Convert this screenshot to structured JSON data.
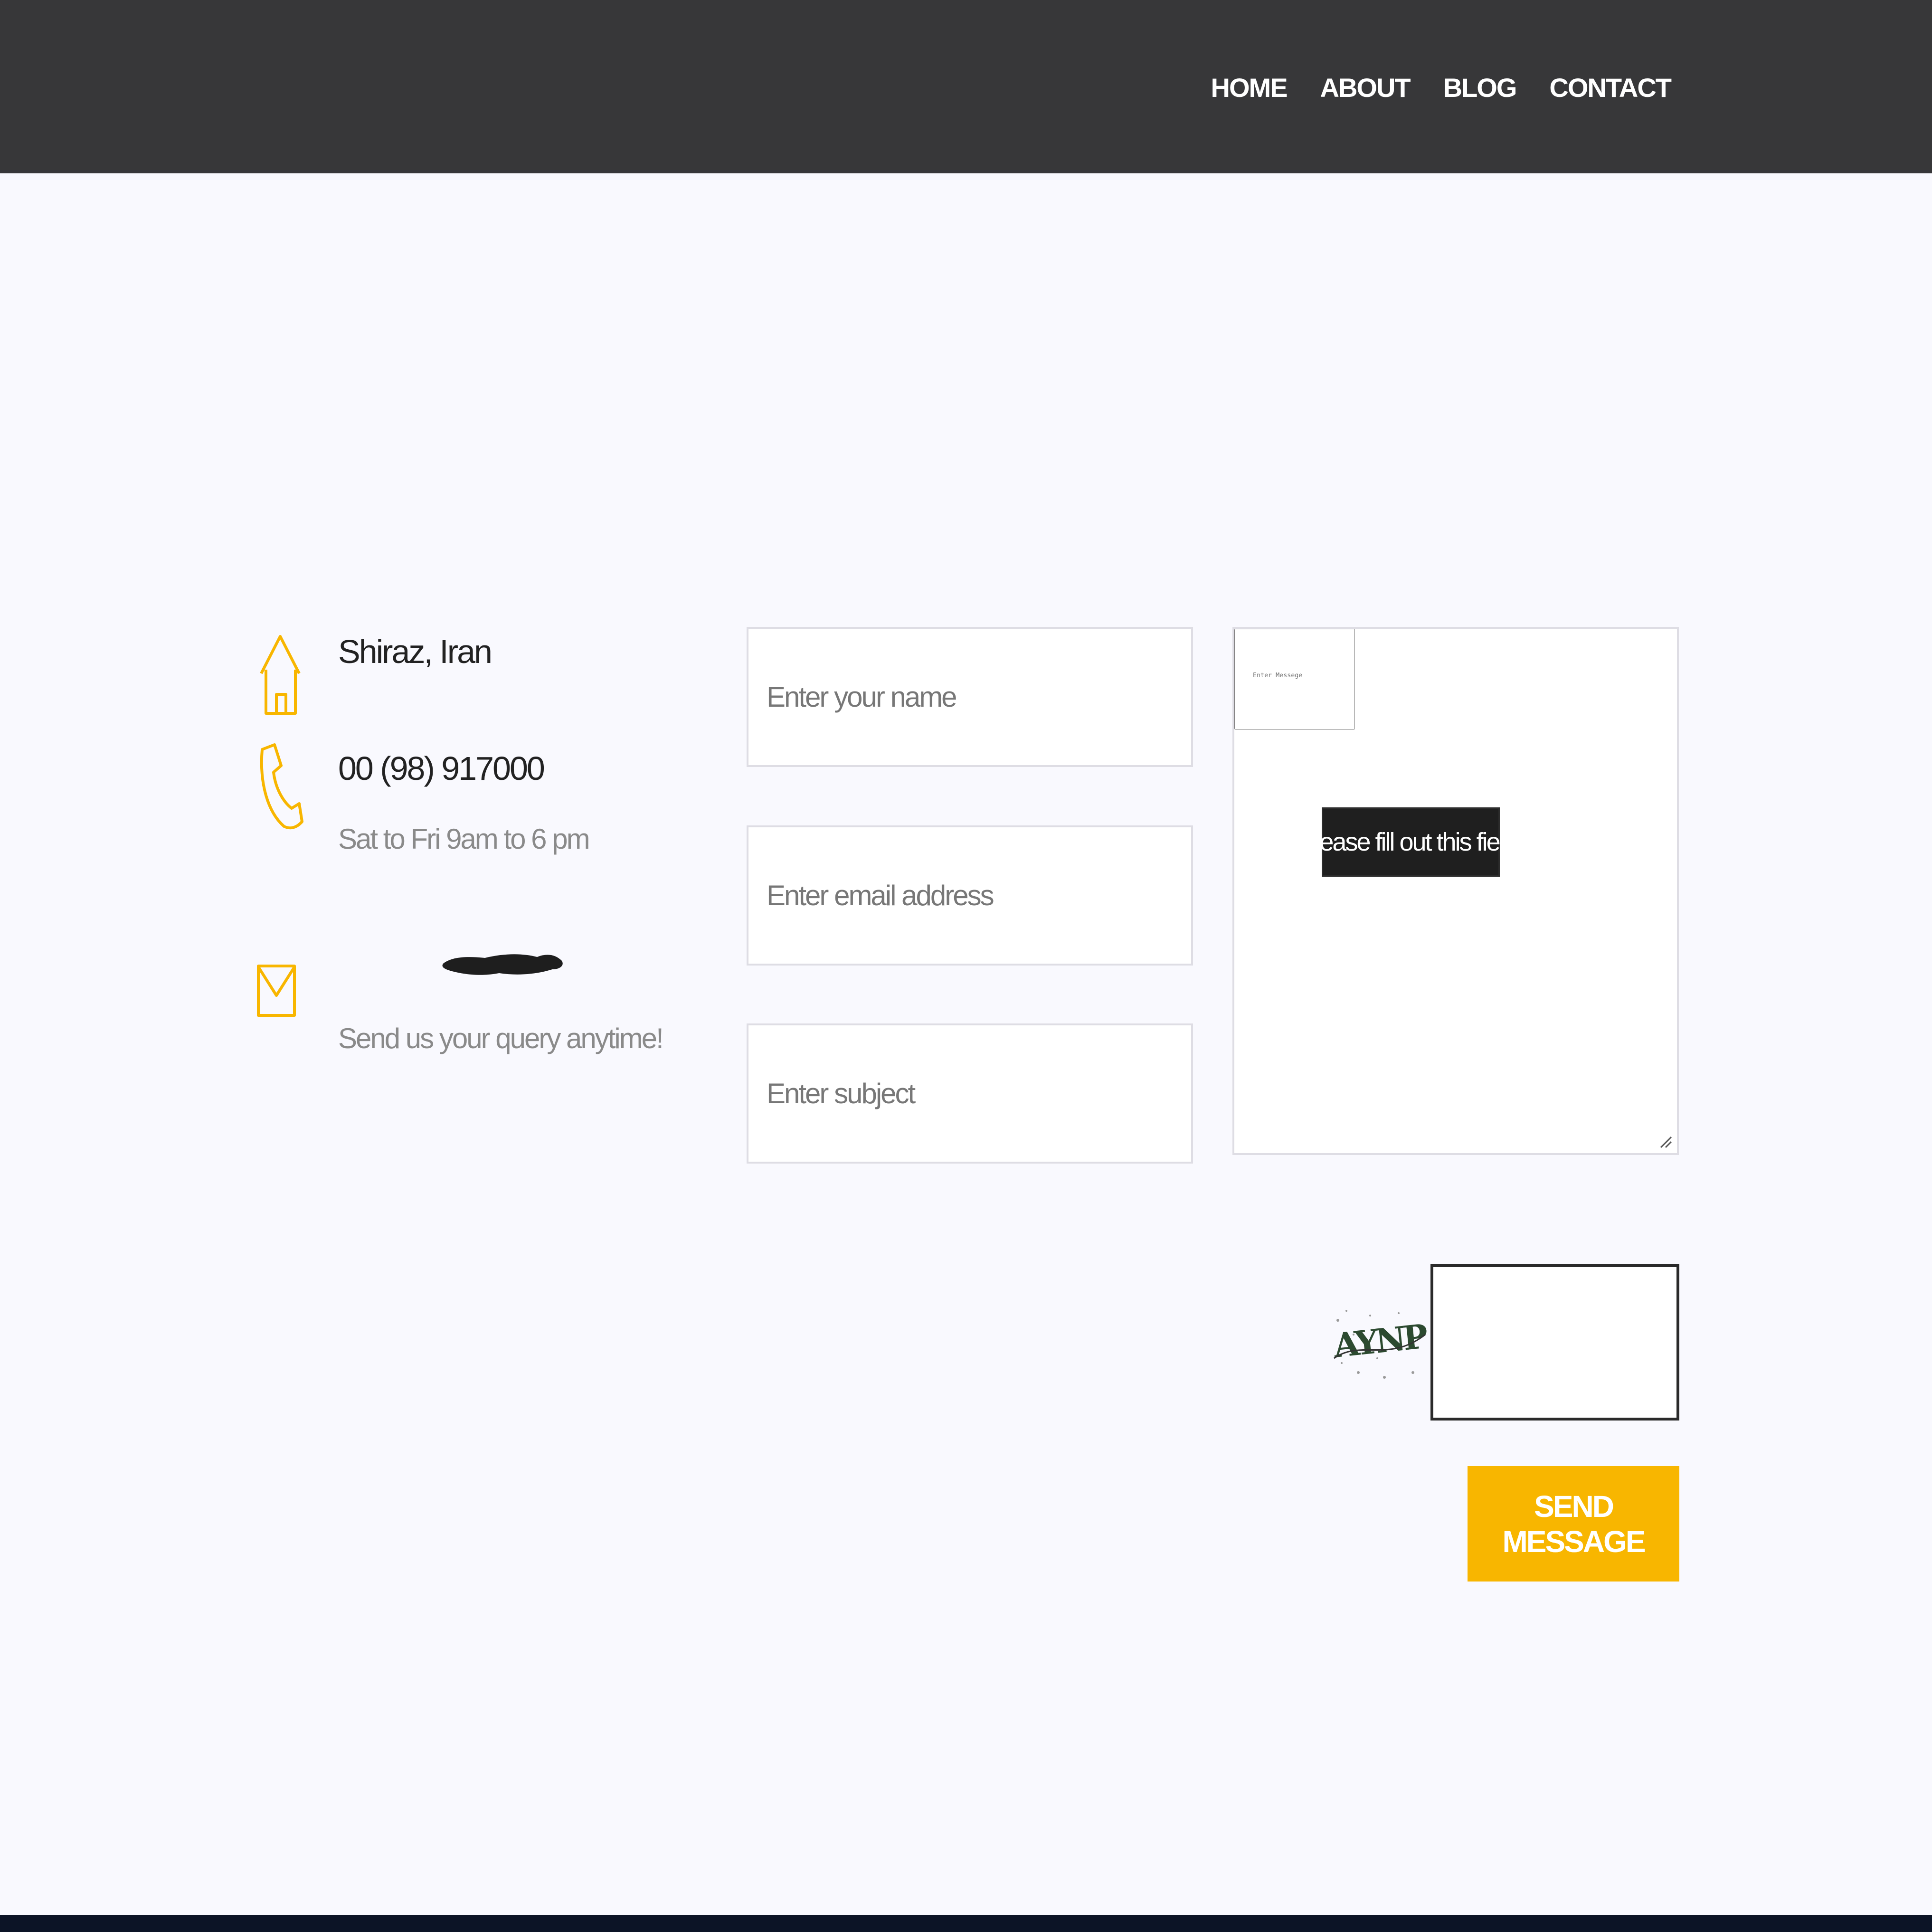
{
  "nav": {
    "items": [
      "HOME",
      "ABOUT",
      "BLOG",
      "CONTACT"
    ]
  },
  "contact": {
    "address": "Shiraz, Iran",
    "phone": "00 (98) 917000",
    "hours": "Sat to Fri 9am to 6 pm",
    "email_note": "Send us your query anytime!"
  },
  "form": {
    "name_placeholder": "Enter your name",
    "email_placeholder": "Enter email address",
    "subject_placeholder": "Enter subject",
    "message_placeholder": "Enter Messege",
    "validation_tooltip": "Please fill out this field.",
    "captcha_text": "AYNP",
    "captcha_value": "",
    "send_label": "SEND MESSAGE"
  },
  "colors": {
    "accent": "#f8b600",
    "header_bg": "#373739",
    "page_bg": "#f9f9fe"
  }
}
